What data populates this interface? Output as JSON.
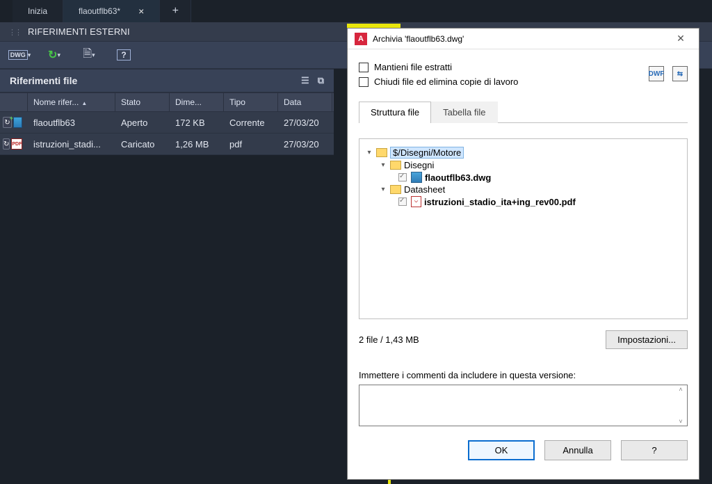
{
  "tabs": {
    "start": "Inizia",
    "file": "flaoutflb63*",
    "new": "+"
  },
  "panel1_title": "RIFERIMENTI ESTERNI",
  "toolbar": {
    "dwg": "DWG",
    "refresh": "↻",
    "file": "🗎",
    "help": "?"
  },
  "panel2_title": "Riferimenti file",
  "columns": {
    "icon": "",
    "name": "Nome rifer...",
    "state": "Stato",
    "size": "Dime...",
    "type": "Tipo",
    "date": "Data"
  },
  "rows": [
    {
      "name": "flaoutflb63",
      "state": "Aperto",
      "size": "172 KB",
      "type": "Corrente",
      "date": "27/03/20",
      "kind": "dwg"
    },
    {
      "name": "istruzioni_stadi...",
      "state": "Caricato",
      "size": "1,26 MB",
      "type": "pdf",
      "date": "27/03/20",
      "kind": "pdf"
    }
  ],
  "dialog": {
    "app_icon": "A",
    "title": "Archivia 'flaoutflb63.dwg'",
    "close": "✕",
    "chk_keep": "Mantieni file estratti",
    "chk_close": "Chiudi file ed elimina copie di lavoro",
    "tab_struct": "Struttura file",
    "tab_table": "Tabella file",
    "tree": {
      "root": "$/Disegni/Motore",
      "folder1": "Disegni",
      "file1": "flaoutflb63.dwg",
      "folder2": "Datasheet",
      "file2": "istruzioni_stadio_ita+ing_rev00.pdf"
    },
    "summary": "2 file / 1,43 MB",
    "settings_btn": "Impostazioni...",
    "comment_label": "Immettere i commenti da includere in questa versione:",
    "ok": "OK",
    "cancel": "Annulla",
    "help": "?"
  }
}
